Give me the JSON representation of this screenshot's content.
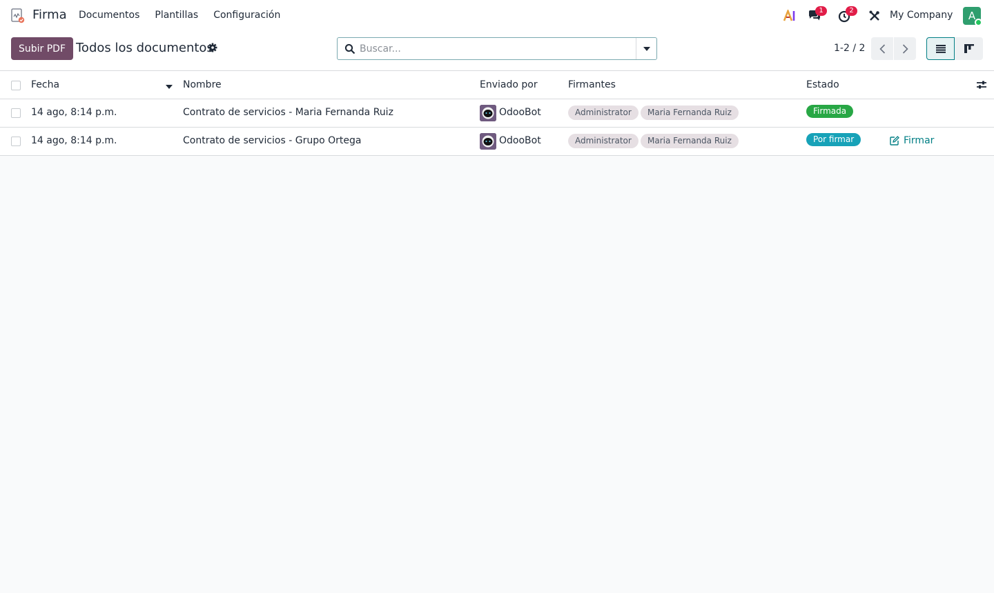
{
  "navbar": {
    "app_name": "Firma",
    "menu": [
      "Documentos",
      "Plantillas",
      "Configuración"
    ],
    "ai_icon_label": "AI",
    "messages_count": "1",
    "activities_count": "2",
    "company": "My Company",
    "user_initial": "A"
  },
  "control": {
    "upload_button": "Subir PDF",
    "breadcrumb": "Todos los documentos",
    "search_placeholder": "Buscar...",
    "pager": "1-2 / 2"
  },
  "table": {
    "columns": [
      "Fecha",
      "Nombre",
      "Enviado por",
      "Firmantes",
      "Estado"
    ],
    "rows": [
      {
        "date": "14 ago, 8:14 p.m.",
        "name": "Contrato de servicios - Maria Fernanda Ruiz",
        "sent_by": "OdooBot",
        "signers": [
          "Administrator",
          "Maria Fernanda Ruiz"
        ],
        "status": "Firmada",
        "status_color": "#28a745",
        "action": ""
      },
      {
        "date": "14 ago, 8:14 p.m.",
        "name": "Contrato de servicios - Grupo Ortega",
        "sent_by": "OdooBot",
        "signers": [
          "Administrator",
          "Maria Fernanda Ruiz"
        ],
        "status": "Por firmar",
        "status_color": "#17a2b8",
        "action": "Firmar"
      }
    ]
  },
  "colors": {
    "brand": "#714b67",
    "accent": "#017e84",
    "badge": "#e11d48",
    "avatar": "#2f9e6e"
  },
  "icons": {
    "app": "sign-app-icon",
    "ai": "ai-icon",
    "messages": "chat-icon",
    "activities": "clock-icon",
    "debug": "tools-icon",
    "settings": "gear-icon",
    "search": "search-icon",
    "toggle": "caret-down-icon",
    "prev": "chevron-left-icon",
    "next": "chevron-right-icon",
    "list_view": "list-view-icon",
    "kanban_view": "kanban-view-icon",
    "sort": "sort-desc-icon",
    "optional_columns": "sliders-icon",
    "sign": "edit-icon"
  }
}
